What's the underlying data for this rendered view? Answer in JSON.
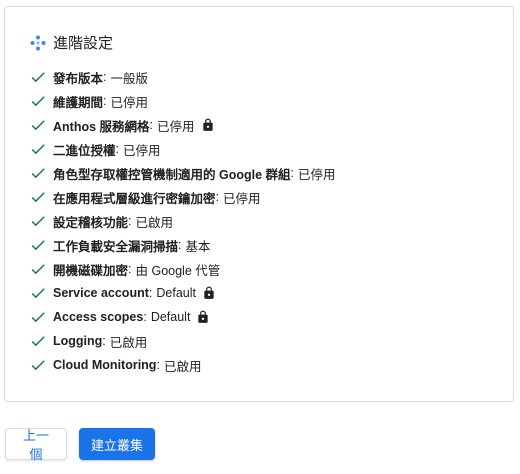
{
  "header": {
    "title": "進階設定",
    "icon": "settings-dots-icon"
  },
  "settings": [
    {
      "label": "發布版本",
      "value": "一般版",
      "locked": false
    },
    {
      "label": "維護期間",
      "value": "已停用",
      "locked": false
    },
    {
      "label": "Anthos 服務網格",
      "value": "已停用",
      "locked": true
    },
    {
      "label": "二進位授權",
      "value": "已停用",
      "locked": false
    },
    {
      "label": "角色型存取權控管機制適用的 Google 群組",
      "value": "已停用",
      "locked": false
    },
    {
      "label": "在應用程式層級進行密鑰加密",
      "value": "已停用",
      "locked": false
    },
    {
      "label": "設定稽核功能",
      "value": "已啟用",
      "locked": false
    },
    {
      "label": "工作負載安全漏洞掃描",
      "value": "基本",
      "locked": false
    },
    {
      "label": "開機磁碟加密",
      "value": "由 Google 代管",
      "locked": false
    },
    {
      "label": "Service account",
      "value": "Default",
      "locked": true
    },
    {
      "label": "Access scopes",
      "value": "Default",
      "locked": true
    },
    {
      "label": "Logging",
      "value": "已啟用",
      "locked": false
    },
    {
      "label": "Cloud Monitoring",
      "value": "已啟用",
      "locked": false
    }
  ],
  "buttons": {
    "back_label": "上一個",
    "create_label": "建立叢集"
  },
  "colors": {
    "check": "#188038",
    "primary": "#1a73e8",
    "border": "#dadce0",
    "text": "#202124"
  }
}
